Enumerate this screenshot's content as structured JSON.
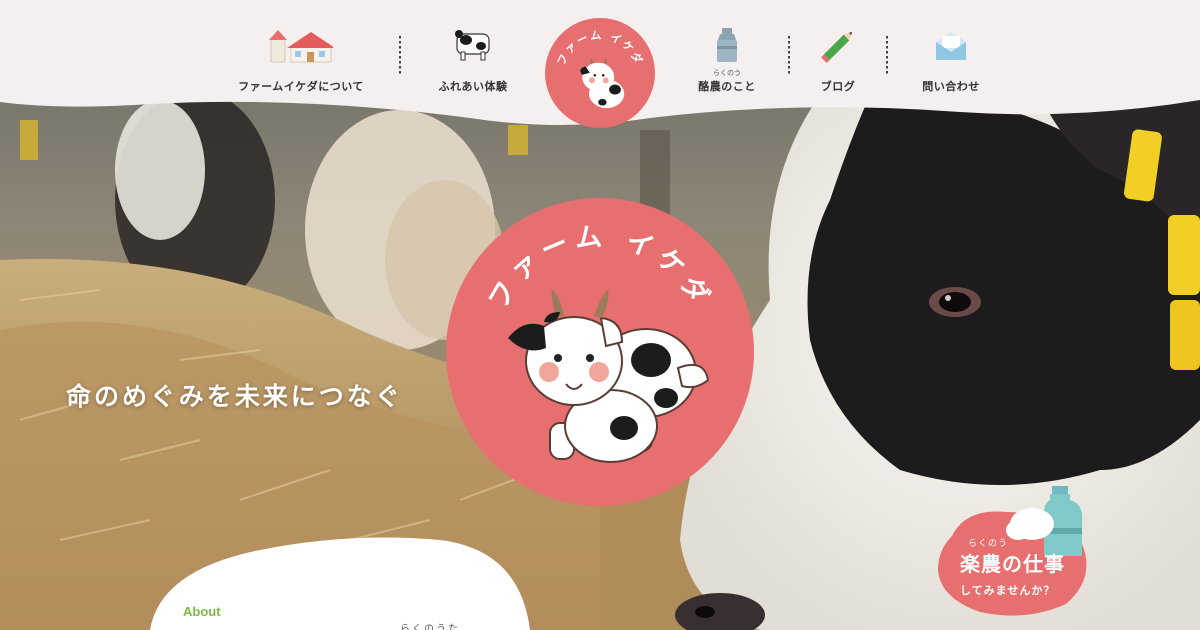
{
  "header": {
    "nav": [
      {
        "label": "ファームイケダについて",
        "ruby": "",
        "icon": "house-icon"
      },
      {
        "label": "ふれあい体験",
        "ruby": "",
        "icon": "cow-icon"
      },
      {
        "label": "酪農のこと",
        "ruby": "らくのう",
        "icon": "milk-can-icon"
      },
      {
        "label": "ブログ",
        "ruby": "",
        "icon": "pencil-icon"
      },
      {
        "label": "問い合わせ",
        "ruby": "",
        "icon": "envelope-icon"
      }
    ],
    "logo_text": "ファーム イケダ"
  },
  "hero": {
    "logo_text": "ファーム イケダ",
    "tagline": "命のめぐみを未来につなぐ"
  },
  "recruit": {
    "ruby": "らくのう",
    "title": "楽農の仕事",
    "subtitle": "してみませんか？"
  },
  "about": {
    "label": "About",
    "ruby": "らくのうた"
  },
  "colors": {
    "brand_red": "#e86f6f",
    "header_bg": "#f5f0ef",
    "about_green": "#7dbb3f"
  }
}
